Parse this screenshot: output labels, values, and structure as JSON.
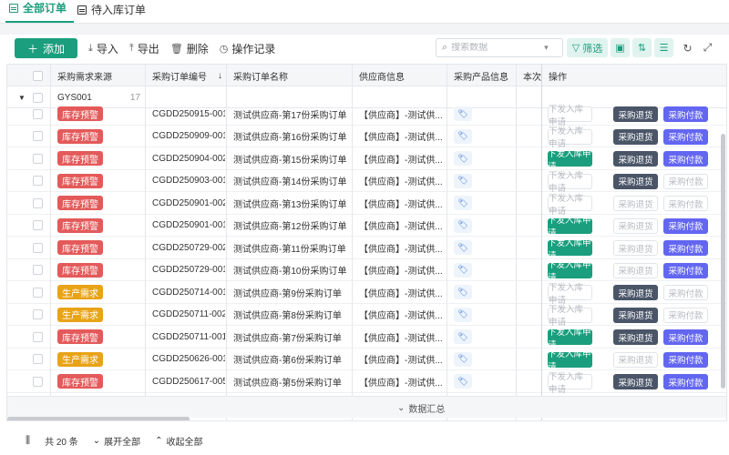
{
  "tabs": [
    {
      "label": "全部订单",
      "active": true
    },
    {
      "label": "待入库订单",
      "active": false
    }
  ],
  "toolbar": {
    "add_label": "添加",
    "import_label": "导入",
    "export_label": "导出",
    "delete_label": "删除",
    "log_label": "操作记录",
    "search_placeholder": "搜索数据",
    "filter_label": "筛选"
  },
  "columns": [
    "采购需求来源",
    "采购订单编号",
    "采购订单名称",
    "供应商信息",
    "采购产品信息",
    "本次",
    "操作"
  ],
  "group": {
    "name": "GYS001",
    "count": "17"
  },
  "rows": [
    {
      "source": "库存预警",
      "source_color": "red",
      "code": "CGDD250915-001",
      "name": "测试供应商-第17份采购订单",
      "supplier": "【供应商】-测试供...",
      "act": [
        "off",
        "on",
        "on"
      ]
    },
    {
      "source": "库存预警",
      "source_color": "red",
      "code": "CGDD250909-001",
      "name": "测试供应商-第16份采购订单",
      "supplier": "【供应商】-测试供...",
      "act": [
        "off",
        "on",
        "on"
      ]
    },
    {
      "source": "库存预警",
      "source_color": "red",
      "code": "CGDD250904-002",
      "name": "测试供应商-第15份采购订单",
      "supplier": "【供应商】-测试供...",
      "act": [
        "on",
        "on",
        "on"
      ]
    },
    {
      "source": "库存预警",
      "source_color": "red",
      "code": "CGDD250903-001",
      "name": "测试供应商-第14份采购订单",
      "supplier": "【供应商】-测试供...",
      "act": [
        "off",
        "on",
        "off"
      ]
    },
    {
      "source": "库存预警",
      "source_color": "red",
      "code": "CGDD250901-002",
      "name": "测试供应商-第13份采购订单",
      "supplier": "【供应商】-测试供...",
      "act": [
        "off",
        "off",
        "off"
      ]
    },
    {
      "source": "库存预警",
      "source_color": "red",
      "code": "CGDD250901-001",
      "name": "测试供应商-第12份采购订单",
      "supplier": "【供应商】-测试供...",
      "act": [
        "on",
        "off",
        "on"
      ]
    },
    {
      "source": "库存预警",
      "source_color": "red",
      "code": "CGDD250729-002",
      "name": "测试供应商-第11份采购订单",
      "supplier": "【供应商】-测试供...",
      "act": [
        "on",
        "off",
        "on"
      ]
    },
    {
      "source": "库存预警",
      "source_color": "red",
      "code": "CGDD250729-001",
      "name": "测试供应商-第10份采购订单",
      "supplier": "【供应商】-测试供...",
      "act": [
        "on",
        "off",
        "on"
      ]
    },
    {
      "source": "生产需求",
      "source_color": "orange",
      "code": "CGDD250714-001",
      "name": "测试供应商-第9份采购订单",
      "supplier": "【供应商】-测试供...",
      "act": [
        "off",
        "on",
        "off"
      ]
    },
    {
      "source": "生产需求",
      "source_color": "orange",
      "code": "CGDD250711-002",
      "name": "测试供应商-第8份采购订单",
      "supplier": "【供应商】-测试供...",
      "act": [
        "off",
        "on",
        "off"
      ]
    },
    {
      "source": "库存预警",
      "source_color": "red",
      "code": "CGDD250711-001",
      "name": "测试供应商-第7份采购订单",
      "supplier": "【供应商】-测试供...",
      "act": [
        "on",
        "on",
        "on"
      ]
    },
    {
      "source": "生产需求",
      "source_color": "orange",
      "code": "CGDD250626-001",
      "name": "测试供应商-第6份采购订单",
      "supplier": "【供应商】-测试供...",
      "act": [
        "on",
        "off",
        "on"
      ]
    },
    {
      "source": "库存预警",
      "source_color": "red",
      "code": "CGDD250617-005",
      "name": "测试供应商-第5份采购订单",
      "supplier": "【供应商】-测试供...",
      "act": [
        "off",
        "on",
        "on"
      ]
    }
  ],
  "action_labels": [
    "下发入库申请",
    "采购退货",
    "采购付款"
  ],
  "summary_label": "数据汇总",
  "footer": {
    "total": "共 20 条",
    "expand_all": "展开全部",
    "collapse_all": "收起全部"
  },
  "colors": {
    "primary": "#1a9e7e",
    "warning_red": "#e45a5a",
    "production_orange": "#e8a317",
    "return_dark": "#4a5568",
    "pay_purple": "#6366f1"
  }
}
